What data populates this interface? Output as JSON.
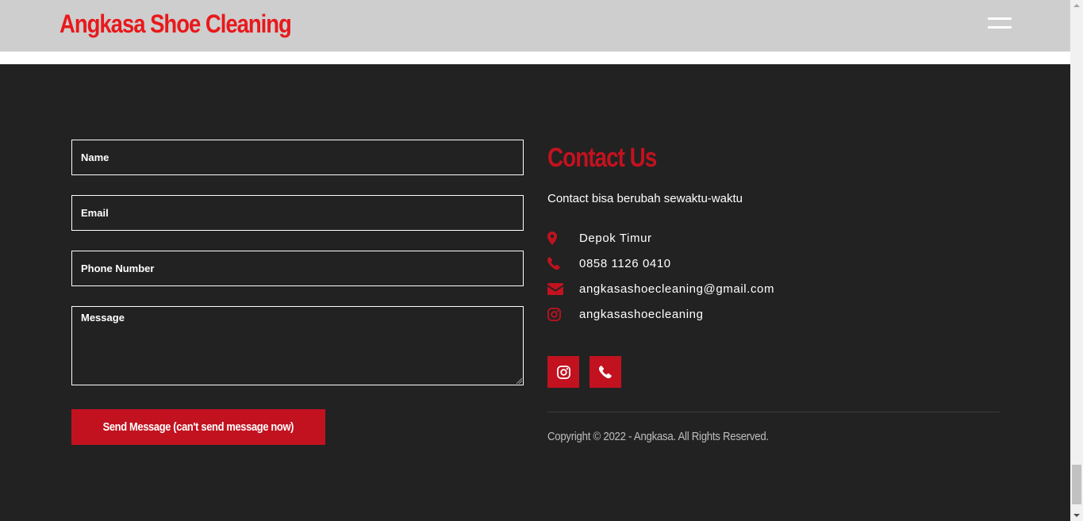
{
  "header": {
    "brand": "Angkasa Shoe Cleaning",
    "menu_icon": "hamburger-menu-icon"
  },
  "form": {
    "name_placeholder": "Name",
    "email_placeholder": "Email",
    "phone_placeholder": "Phone Number",
    "message_placeholder": "Message",
    "send_label": "Send Message (can't send message now)"
  },
  "contact": {
    "title": "Contact Us",
    "subtitle": "Contact bisa berubah sewaktu-waktu",
    "items": [
      {
        "icon": "map-pin-icon",
        "text": "Depok Timur"
      },
      {
        "icon": "phone-icon",
        "text": "0858 1126 0410"
      },
      {
        "icon": "envelope-icon",
        "text": "angkasashoecleaning@gmail.com"
      },
      {
        "icon": "instagram-icon",
        "text": "angkasashoecleaning"
      }
    ],
    "social": [
      {
        "icon": "instagram-icon"
      },
      {
        "icon": "phone-icon"
      }
    ]
  },
  "footer": {
    "copyright": "Copyright © 2022 - Angkasa. All Rights Reserved."
  },
  "colors": {
    "brand": "#e8191c",
    "accent": "#c2121f",
    "footer_bg": "#222222",
    "header_bg": "#cecece"
  }
}
